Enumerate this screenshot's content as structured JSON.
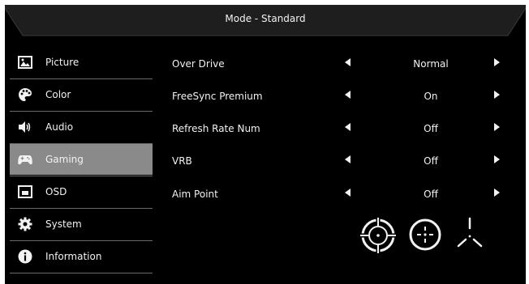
{
  "header": {
    "title": "Mode - Standard"
  },
  "sidebar": {
    "items": [
      {
        "label": "Picture",
        "icon": "picture-icon",
        "selected": false
      },
      {
        "label": "Color",
        "icon": "palette-icon",
        "selected": false
      },
      {
        "label": "Audio",
        "icon": "speaker-icon",
        "selected": false
      },
      {
        "label": "Gaming",
        "icon": "gamepad-icon",
        "selected": true
      },
      {
        "label": "OSD",
        "icon": "osd-icon",
        "selected": false
      },
      {
        "label": "System",
        "icon": "gear-icon",
        "selected": false
      },
      {
        "label": "Information",
        "icon": "info-icon",
        "selected": false
      }
    ]
  },
  "settings": [
    {
      "name": "Over Drive",
      "value": "Normal"
    },
    {
      "name": "FreeSync Premium",
      "value": "On"
    },
    {
      "name": "Refresh Rate Num",
      "value": "Off"
    },
    {
      "name": "VRB",
      "value": "Off"
    },
    {
      "name": "Aim Point",
      "value": "Off"
    }
  ],
  "aim_point_options": [
    "crosshair-ring-icon",
    "crosshair-circle-icon",
    "crosshair-tripod-icon"
  ],
  "colors": {
    "background": "#000000",
    "selected": "#8a8a8a",
    "text": "#f2f2f2"
  }
}
